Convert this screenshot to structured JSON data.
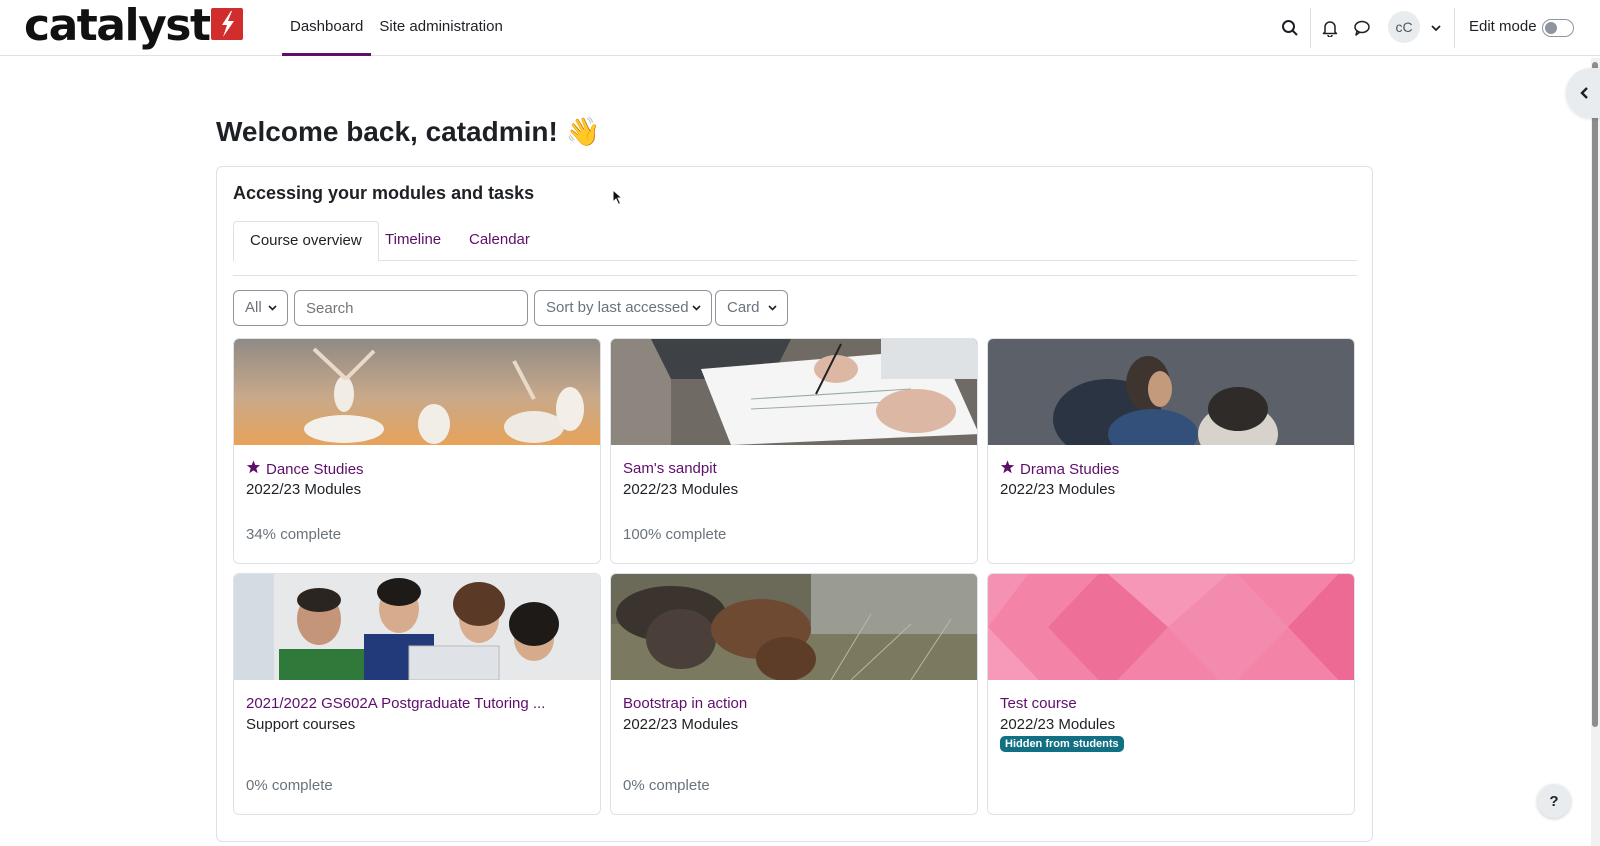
{
  "header": {
    "logo_text": "catalyst",
    "nav": [
      {
        "label": "Dashboard",
        "active": true
      },
      {
        "label": "Site administration",
        "active": false
      }
    ],
    "icons": [
      "search-icon",
      "bell-icon",
      "message-icon"
    ],
    "user_initials": "cC",
    "edit_mode_label": "Edit mode",
    "edit_mode_on": false
  },
  "main": {
    "welcome": "Welcome back, catadmin! 👋",
    "block_title": "Accessing your modules and tasks",
    "tabs": [
      {
        "label": "Course overview",
        "active": true
      },
      {
        "label": "Timeline",
        "active": false
      },
      {
        "label": "Calendar",
        "active": false
      }
    ],
    "filters": {
      "grouping": "All",
      "search_placeholder": "Search",
      "sort": "Sort by last accessed",
      "view": "Card"
    },
    "courses": [
      {
        "title": "Dance Studies",
        "starred": true,
        "category": "2022/23 Modules",
        "progress": "34% complete",
        "image": "dancers-photo"
      },
      {
        "title": "Sam's sandpit",
        "starred": false,
        "category": "2022/23 Modules",
        "progress": "100% complete",
        "image": "writing-desk-photo"
      },
      {
        "title": "Drama Studies",
        "starred": true,
        "category": "2022/23 Modules",
        "progress": "",
        "image": "drama-actors-photo"
      },
      {
        "title": "2021/2022 GS602A Postgraduate Tutoring ...",
        "starred": false,
        "category": "Support courses",
        "progress": "0% complete",
        "image": "students-laptop-photo"
      },
      {
        "title": "Bootstrap in action",
        "starred": false,
        "category": "2022/23 Modules",
        "progress": "0% complete",
        "image": "boots-grass-photo"
      },
      {
        "title": "Test course",
        "starred": false,
        "category": "2022/23 Modules",
        "progress": "",
        "badge": "Hidden from students",
        "image": "pink-pattern"
      }
    ]
  },
  "help_label": "?",
  "colors": {
    "brand": "#5e0f6b",
    "logo_red": "#d12d2d",
    "badge": "#117083",
    "border": "#dee2e6"
  }
}
